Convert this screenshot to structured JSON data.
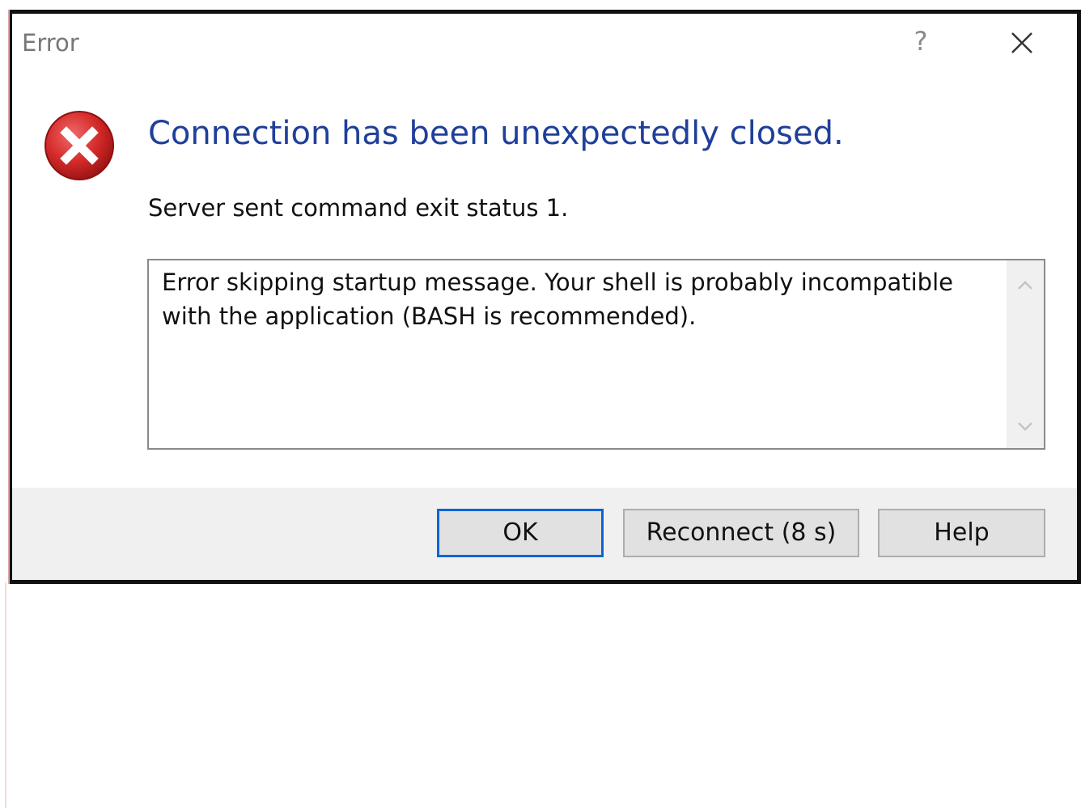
{
  "window": {
    "title": "Error"
  },
  "title_bar": {
    "help_symbol": "?",
    "close_icon": "close-icon"
  },
  "content": {
    "icon": "error-icon",
    "main_instruction": "Connection has been unexpectedly closed.",
    "sub_text": "Server sent command exit status 1.",
    "details": "Error skipping startup message. Your shell is probably incompatible with the application (BASH is recommended)."
  },
  "buttons": {
    "ok_label": "OK",
    "reconnect_label": "Reconnect (8 s)",
    "help_label": "Help"
  },
  "colors": {
    "main_instruction": "#1f3f9a",
    "default_button_border": "#0a64d8",
    "error_icon_red": "#d42a2a"
  }
}
